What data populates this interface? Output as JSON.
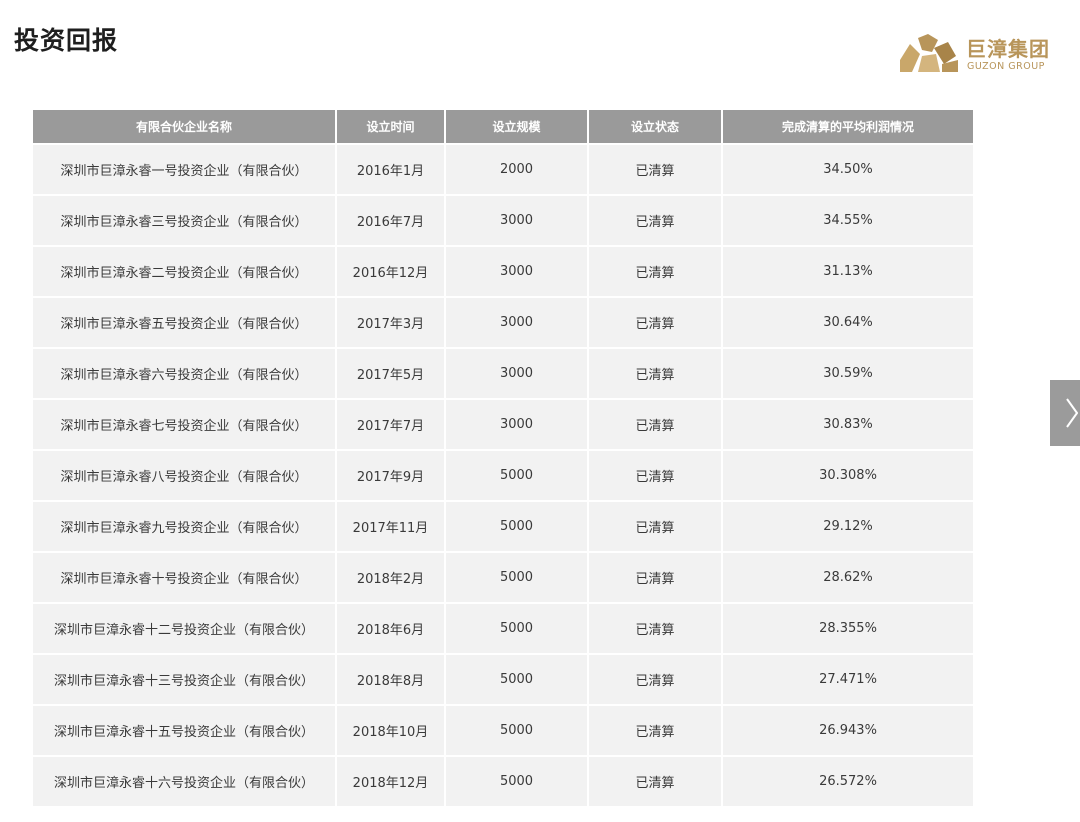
{
  "title": "投资回报",
  "brand": {
    "name": "巨漳集团",
    "sub": "GUZON GROUP",
    "color": "#b8955a"
  },
  "table": {
    "headers": [
      "有限合伙企业名称",
      "设立时间",
      "设立规模",
      "设立状态",
      "完成清算的平均利润情况"
    ],
    "rows": [
      [
        "深圳市巨漳永睿一号投资企业（有限合伙）",
        "2016年1月",
        "2000",
        "已清算",
        "34.50%"
      ],
      [
        "深圳市巨漳永睿三号投资企业（有限合伙）",
        "2016年7月",
        "3000",
        "已清算",
        "34.55%"
      ],
      [
        "深圳市巨漳永睿二号投资企业（有限合伙）",
        "2016年12月",
        "3000",
        "已清算",
        "31.13%"
      ],
      [
        "深圳市巨漳永睿五号投资企业（有限合伙）",
        "2017年3月",
        "3000",
        "已清算",
        "30.64%"
      ],
      [
        "深圳市巨漳永睿六号投资企业（有限合伙）",
        "2017年5月",
        "3000",
        "已清算",
        "30.59%"
      ],
      [
        "深圳市巨漳永睿七号投资企业（有限合伙）",
        "2017年7月",
        "3000",
        "已清算",
        "30.83%"
      ],
      [
        "深圳市巨漳永睿八号投资企业（有限合伙）",
        "2017年9月",
        "5000",
        "已清算",
        "30.308%"
      ],
      [
        "深圳市巨漳永睿九号投资企业（有限合伙）",
        "2017年11月",
        "5000",
        "已清算",
        "29.12%"
      ],
      [
        "深圳市巨漳永睿十号投资企业（有限合伙）",
        "2018年2月",
        "5000",
        "已清算",
        "28.62%"
      ],
      [
        "深圳市巨漳永睿十二号投资企业（有限合伙）",
        "2018年6月",
        "5000",
        "已清算",
        "28.355%"
      ],
      [
        "深圳市巨漳永睿十三号投资企业（有限合伙）",
        "2018年8月",
        "5000",
        "已清算",
        "27.471%"
      ],
      [
        "深圳市巨漳永睿十五号投资企业（有限合伙）",
        "2018年10月",
        "5000",
        "已清算",
        "26.943%"
      ],
      [
        "深圳市巨漳永睿十六号投资企业（有限合伙）",
        "2018年12月",
        "5000",
        "已清算",
        "26.572%"
      ]
    ]
  },
  "nav": {
    "next_icon": "chevron-right-icon"
  }
}
